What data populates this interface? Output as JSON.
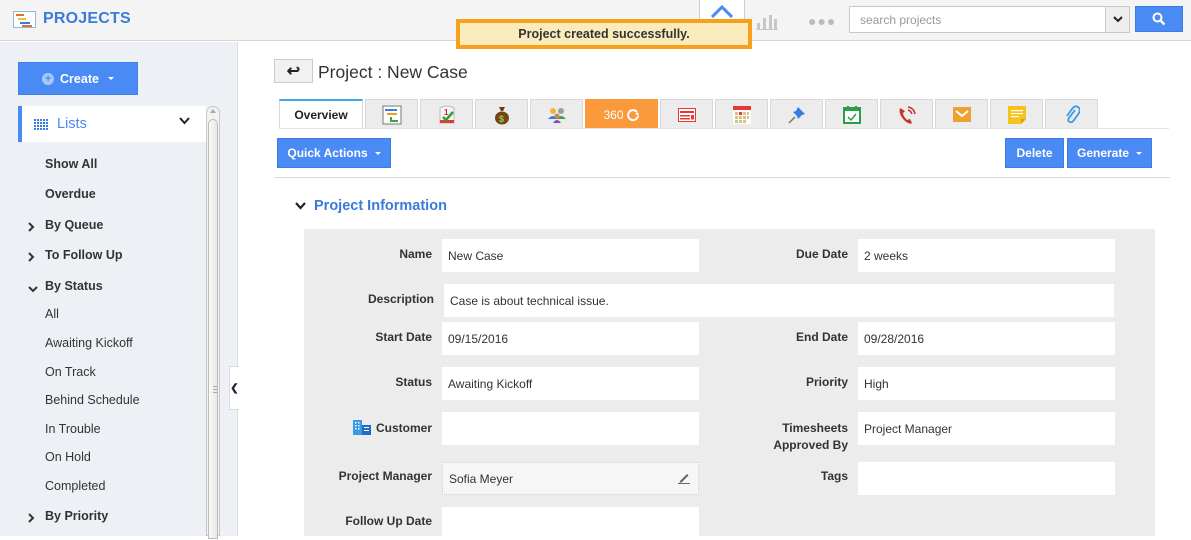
{
  "header": {
    "app_title": "PROJECTS",
    "search": {
      "placeholder": "search projects",
      "value": ""
    },
    "icons": [
      "projects-logo-icon",
      "home-icon",
      "bar-chart-icon",
      "more-dots-icon",
      "search-icon"
    ]
  },
  "toast": {
    "message": "Project created successfully."
  },
  "sidebar": {
    "create_label": "Create",
    "lists_label": "Lists",
    "items": [
      {
        "label": "Show All",
        "bold": true,
        "arrow": ""
      },
      {
        "label": "Overdue",
        "bold": true,
        "arrow": ""
      },
      {
        "label": "By Queue",
        "bold": true,
        "arrow": "›"
      },
      {
        "label": "To Follow Up",
        "bold": true,
        "arrow": "›"
      },
      {
        "label": "By Status",
        "bold": true,
        "arrow": "⌄"
      },
      {
        "label": "All",
        "bold": false,
        "arrow": ""
      },
      {
        "label": "Awaiting Kickoff",
        "bold": false,
        "arrow": ""
      },
      {
        "label": "On Track",
        "bold": false,
        "arrow": ""
      },
      {
        "label": "Behind Schedule",
        "bold": false,
        "arrow": ""
      },
      {
        "label": "In Trouble",
        "bold": false,
        "arrow": ""
      },
      {
        "label": "On Hold",
        "bold": false,
        "arrow": ""
      },
      {
        "label": "Completed",
        "bold": false,
        "arrow": ""
      },
      {
        "label": "By Priority",
        "bold": true,
        "arrow": "›"
      }
    ]
  },
  "main": {
    "page_title": "Project : New Case",
    "tabs": [
      {
        "label": "Overview",
        "icon": ""
      },
      {
        "label": "",
        "icon": "gantt-icon"
      },
      {
        "label": "",
        "icon": "task-icon"
      },
      {
        "label": "",
        "icon": "money-bag-icon"
      },
      {
        "label": "",
        "icon": "team-icon"
      },
      {
        "label": "360",
        "icon": "refresh-icon"
      },
      {
        "label": "",
        "icon": "invoice-icon"
      },
      {
        "label": "",
        "icon": "calendar-icon"
      },
      {
        "label": "",
        "icon": "pin-icon"
      },
      {
        "label": "",
        "icon": "event-check-icon"
      },
      {
        "label": "",
        "icon": "phone-icon"
      },
      {
        "label": "",
        "icon": "email-icon"
      },
      {
        "label": "",
        "icon": "note-icon"
      },
      {
        "label": "",
        "icon": "attachment-icon"
      }
    ],
    "buttons": {
      "quick_actions": "Quick Actions",
      "delete": "Delete",
      "generate": "Generate"
    },
    "section_title": "Project Information",
    "fields": {
      "name": {
        "label": "Name",
        "value": "New Case"
      },
      "due_date": {
        "label": "Due Date",
        "value": "2 weeks"
      },
      "description": {
        "label": "Description",
        "value": "Case is about technical issue."
      },
      "start_date": {
        "label": "Start Date",
        "value": "09/15/2016"
      },
      "end_date": {
        "label": "End Date",
        "value": "09/28/2016"
      },
      "status": {
        "label": "Status",
        "value": "Awaiting Kickoff"
      },
      "priority": {
        "label": "Priority",
        "value": "High"
      },
      "customer": {
        "label": "Customer",
        "value": ""
      },
      "timesheets": {
        "label_line1": "Timesheets",
        "label_line2": "Approved By",
        "value": "Project Manager"
      },
      "project_manager": {
        "label": "Project Manager",
        "value": "Sofia Meyer"
      },
      "tags": {
        "label": "Tags",
        "value": ""
      },
      "follow_up_date": {
        "label": "Follow Up Date",
        "value": ""
      }
    }
  },
  "colors": {
    "accent_blue": "#4a8af4",
    "title_blue": "#3a7ad8",
    "toast_bg": "#f9ebbc",
    "toast_border": "#f7a01c",
    "tab_360": "#fa9a3c"
  }
}
